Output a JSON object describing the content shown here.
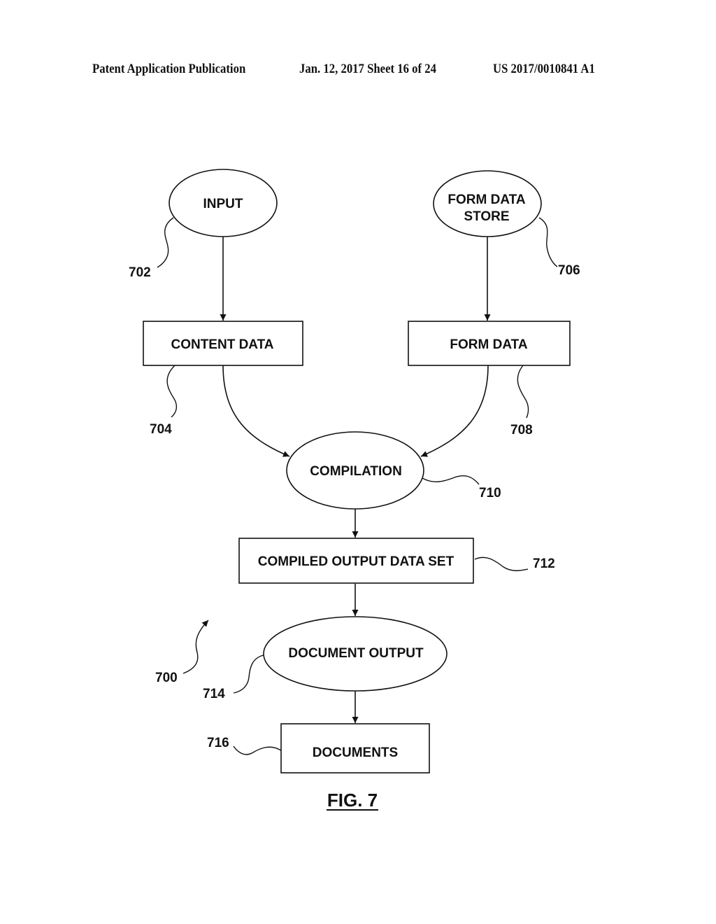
{
  "header": {
    "publication": "Patent Application Publication",
    "date_sheet": "Jan. 12, 2017  Sheet 16 of 24",
    "number": "US 2017/0010841 A1"
  },
  "figure": {
    "label": "FIG. 7",
    "ref": "700"
  },
  "nodes": {
    "input": {
      "shape": "ellipse",
      "lines": [
        "INPUT"
      ],
      "ref": "702"
    },
    "content_data": {
      "shape": "rect",
      "lines": [
        "CONTENT DATA"
      ],
      "ref": "704"
    },
    "form_data_store": {
      "shape": "ellipse",
      "lines": [
        "FORM DATA",
        "STORE"
      ],
      "ref": "706"
    },
    "form_data": {
      "shape": "rect",
      "lines": [
        "FORM DATA"
      ],
      "ref": "708"
    },
    "compilation": {
      "shape": "ellipse",
      "lines": [
        "COMPILATION"
      ],
      "ref": "710"
    },
    "compiled_output": {
      "shape": "rect",
      "lines": [
        "COMPILED OUTPUT DATA SET"
      ],
      "ref": "712"
    },
    "document_output": {
      "shape": "ellipse",
      "lines": [
        "DOCUMENT OUTPUT"
      ],
      "ref": "714"
    },
    "documents": {
      "shape": "rect",
      "lines": [
        "DOCUMENTS"
      ],
      "ref": "716"
    }
  },
  "edges": [
    {
      "from": "input",
      "to": "content_data"
    },
    {
      "from": "form_data_store",
      "to": "form_data"
    },
    {
      "from": "content_data",
      "to": "compilation"
    },
    {
      "from": "form_data",
      "to": "compilation"
    },
    {
      "from": "compilation",
      "to": "compiled_output"
    },
    {
      "from": "compiled_output",
      "to": "document_output"
    },
    {
      "from": "document_output",
      "to": "documents"
    }
  ]
}
